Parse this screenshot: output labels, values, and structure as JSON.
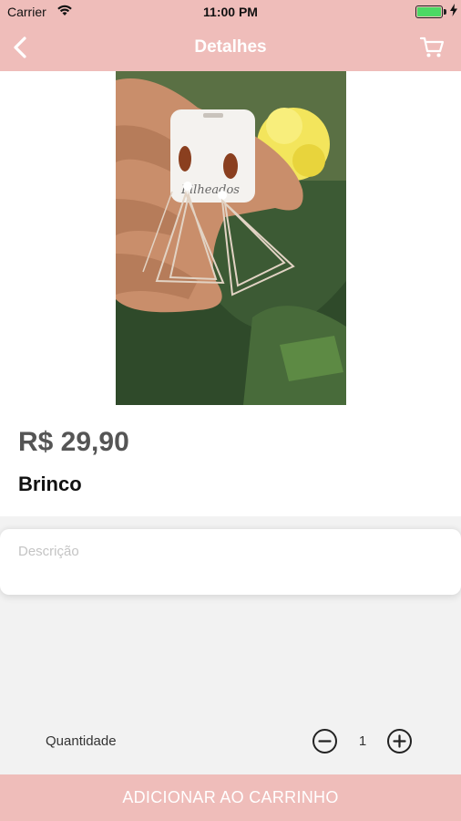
{
  "status_bar": {
    "carrier": "Carrier",
    "time": "11:00 PM",
    "wifi_icon": "wifi-icon",
    "battery_icon": "battery-icon",
    "charging_icon": "bolt-icon"
  },
  "nav": {
    "title": "Detalhes",
    "back_icon": "chevron-left-icon",
    "cart_icon": "cart-icon"
  },
  "product": {
    "image_alt": "photo-earrings-held-in-hand",
    "price": "R$ 29,90",
    "name": "Brinco"
  },
  "description": {
    "label": "Descrição"
  },
  "quantity": {
    "label": "Quantidade",
    "value": "1",
    "minus_icon": "minus-circle-icon",
    "plus_icon": "plus-circle-icon"
  },
  "cta": {
    "label": "ADICIONAR AO CARRINHO"
  },
  "colors": {
    "accent": "#efbdba",
    "background": "#f2f2f2",
    "price_text": "#555555",
    "placeholder_text": "#c4c4c4"
  }
}
